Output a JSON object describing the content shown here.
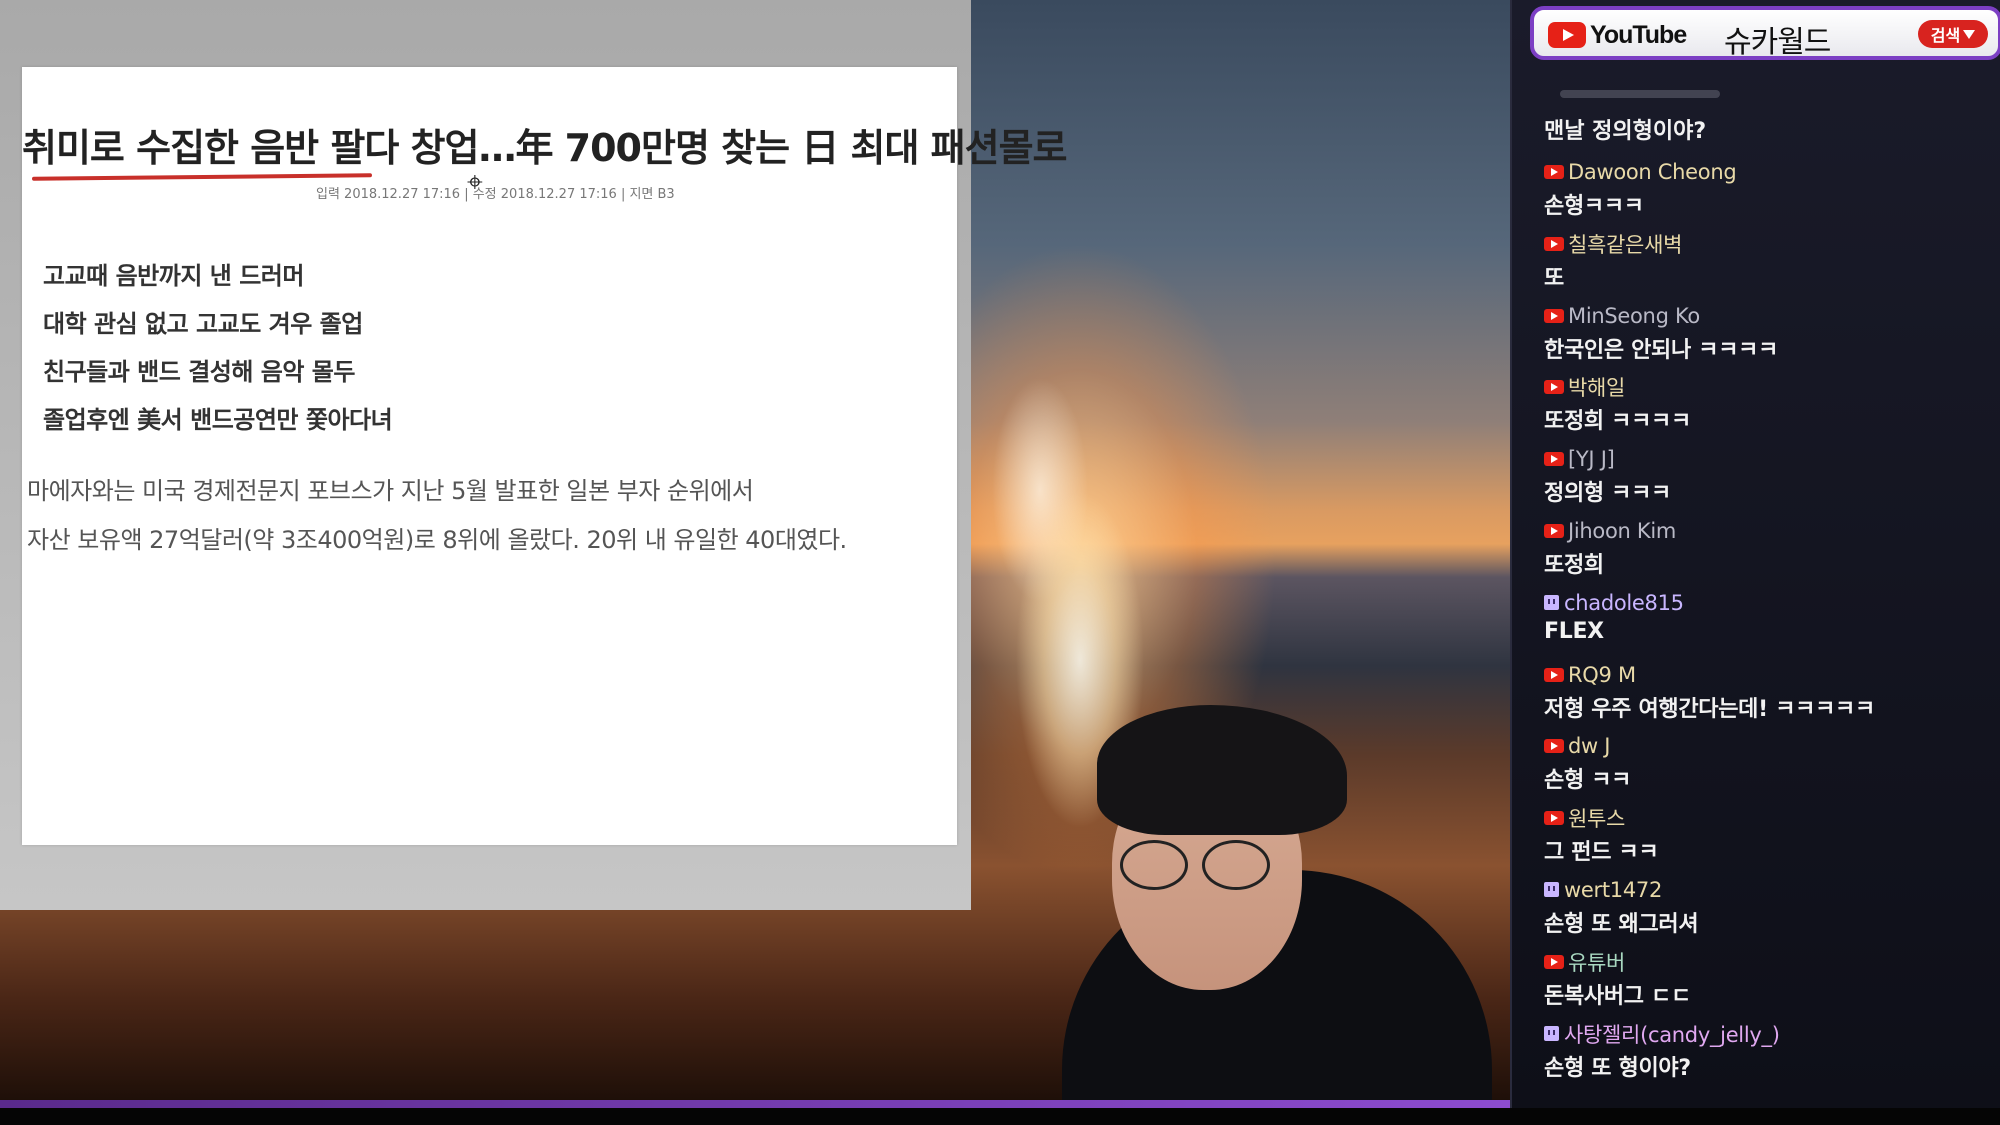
{
  "article": {
    "headline": "취미로 수집한 음반 팔다 창업…年 700만명 찾는 日 최대 패션몰로",
    "byline": "입력 2018.12.27 17:16 | 수정 2018.12.27 17:16 | 지면 B3",
    "subheads": [
      "고교때 음반까지 낸 드러머",
      "대학 관심 없고 고교도 겨우 졸업",
      "친구들과 밴드 결성해 음악 몰두",
      "졸업후엔 美서 밴드공연만 쫓아다녀"
    ],
    "body": [
      "마에자와는 미국 경제전문지 포브스가 지난 5월 발표한 일본 부자 순위에서",
      "자산 보유액 27억달러(약 3조400억원)로 8위에 올랐다. 20위 내 유일한 40대였다."
    ]
  },
  "chat": {
    "header": {
      "logo_text": "YouTube",
      "channel": "슈카월드",
      "search_label": "검색"
    },
    "first_message_text": "맨날 정의형이야?",
    "messages": [
      {
        "platform": "youtube",
        "author": "Dawoon Cheong",
        "color": "#e8d9a8",
        "text": "손형ㅋㅋㅋ"
      },
      {
        "platform": "youtube",
        "author": "칠흑같은새벽",
        "color": "#e8d9a8",
        "text": "또"
      },
      {
        "platform": "youtube",
        "author": "MinSeong Ko",
        "color": "#b9b9c6",
        "text": "한국인은 안되나 ㅋㅋㅋㅋ"
      },
      {
        "platform": "youtube",
        "author": "박해일",
        "color": "#e8d9a8",
        "text": "또정희 ㅋㅋㅋㅋ"
      },
      {
        "platform": "youtube",
        "author": "[YJ J]",
        "color": "#b9b9c6",
        "text": "정의형 ㅋㅋㅋ"
      },
      {
        "platform": "youtube",
        "author": "Jihoon Kim",
        "color": "#b9b9c6",
        "text": "또정희"
      },
      {
        "platform": "twitch",
        "author": "chadole815",
        "color": "#c9b6ff",
        "text": "FLEX"
      },
      {
        "platform": "youtube",
        "author": "RQ9 M",
        "color": "#e8d9a8",
        "text": "저형 우주 여행간다는데! ㅋㅋㅋㅋㅋ"
      },
      {
        "platform": "youtube",
        "author": "dw J",
        "color": "#e8d9a8",
        "text": "손형 ㅋㅋ"
      },
      {
        "platform": "youtube",
        "author": "원투스",
        "color": "#e8d9a8",
        "text": "그 펀드 ㅋㅋ"
      },
      {
        "platform": "twitch",
        "author": "wert1472",
        "color": "#e8d9a8",
        "text": "손형 또 왜그러셔"
      },
      {
        "platform": "youtube",
        "author": "유튜버",
        "color": "#a9d8c0",
        "text": "돈복사버그 ㄷㄷ"
      },
      {
        "platform": "twitch",
        "author": "사탕젤리(candy_jelly_)",
        "color": "#e0a8f0",
        "text": "손형 또 형이야?"
      }
    ]
  },
  "colors": {
    "accent_purple": "#7c3fc4",
    "youtube_red": "#e62117",
    "headline_underline": "#c8302a"
  }
}
